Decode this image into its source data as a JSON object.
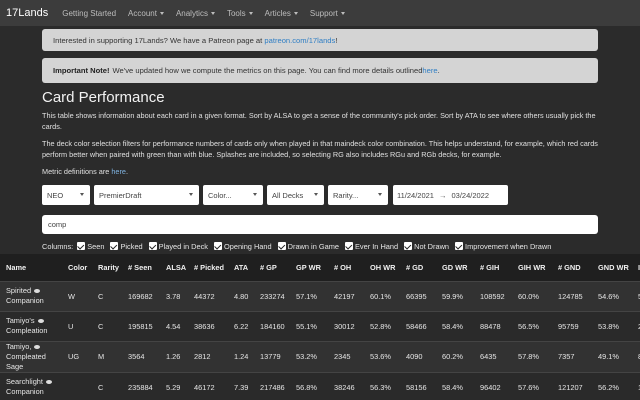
{
  "nav": {
    "brand": "17Lands",
    "items": [
      {
        "label": "Getting Started",
        "dropdown": false
      },
      {
        "label": "Account",
        "dropdown": true
      },
      {
        "label": "Analytics",
        "dropdown": true
      },
      {
        "label": "Tools",
        "dropdown": true
      },
      {
        "label": "Articles",
        "dropdown": true
      },
      {
        "label": "Support",
        "dropdown": true
      }
    ]
  },
  "alerts": {
    "patreon_text": "Interested in supporting 17Lands? We have a Patreon page at ",
    "patreon_link": "patreon.com/17lands",
    "patreon_end": "!",
    "note_bold": "Important Note!",
    "note_text": "We've updated how we compute the metrics on this page. You can find more details outlined ",
    "note_link": "here",
    "note_end": "."
  },
  "page": {
    "title": "Card Performance",
    "para1": "This table shows information about each card in a given format. Sort by ALSA to get a sense of the community's pick order. Sort by ATA to see where others usually pick the cards.",
    "para2": "The deck color selection filters for performance numbers of cards only when played in that maindeck color combination. This helps understand, for example, which red cards perform better when paired with green than with blue. Splashes are included, so selecting RG also includes RGu and RGb decks, for example.",
    "metric_prefix": "Metric definitions are ",
    "metric_link": "here",
    "metric_end": "."
  },
  "filters": {
    "set": "NEO",
    "format": "PremierDraft",
    "color": "Color...",
    "decks": "All Decks",
    "rarity": "Rarity...",
    "start_date": "11/24/2021",
    "arrow": "→",
    "end_date": "03/24/2022",
    "search_value": "comp"
  },
  "columns": {
    "label": "Columns:",
    "options": [
      "Seen",
      "Picked",
      "Played in Deck",
      "Opening Hand",
      "Drawn in Game",
      "Ever In Hand",
      "Not Drawn",
      "Improvement when Drawn"
    ]
  },
  "table": {
    "headers": [
      "Name",
      "Color",
      "Rarity",
      "# Seen",
      "ALSA",
      "# Picked",
      "ATA",
      "# GP",
      "GP WR",
      "# OH",
      "OH WR",
      "# GD",
      "GD WR",
      "# GIH",
      "GIH WR",
      "# GND",
      "GND WR",
      "IW"
    ],
    "rows": [
      {
        "name_lines": [
          "Spirited",
          "Companion"
        ],
        "cells": [
          "W",
          "C",
          "169682",
          "3.78",
          "44372",
          "4.80",
          "233274",
          "57.1%",
          "42197",
          "60.1%",
          "66395",
          "59.9%",
          "108592",
          "60.0%",
          "124785",
          "54.6%",
          "5.4"
        ]
      },
      {
        "name_lines": [
          "Tamiyo's",
          "Compleation"
        ],
        "cells": [
          "U",
          "C",
          "195815",
          "4.54",
          "38636",
          "6.22",
          "184160",
          "55.1%",
          "30012",
          "52.8%",
          "58466",
          "58.4%",
          "88478",
          "56.5%",
          "95759",
          "53.8%",
          "2.7"
        ]
      },
      {
        "name_lines": [
          "Tamiyo,",
          "Compleated",
          "Sage"
        ],
        "cells": [
          "UG",
          "M",
          "3564",
          "1.26",
          "2812",
          "1.24",
          "13779",
          "53.2%",
          "2345",
          "53.6%",
          "4090",
          "60.2%",
          "6435",
          "57.8%",
          "7357",
          "49.1%",
          "8.7"
        ]
      },
      {
        "name_lines": [
          "Searchlight",
          "Companion"
        ],
        "cells": [
          "",
          "C",
          "235884",
          "5.29",
          "46172",
          "7.39",
          "217486",
          "56.8%",
          "38246",
          "56.3%",
          "58156",
          "58.4%",
          "96402",
          "57.6%",
          "121207",
          "56.2%",
          "1.4"
        ]
      }
    ]
  }
}
